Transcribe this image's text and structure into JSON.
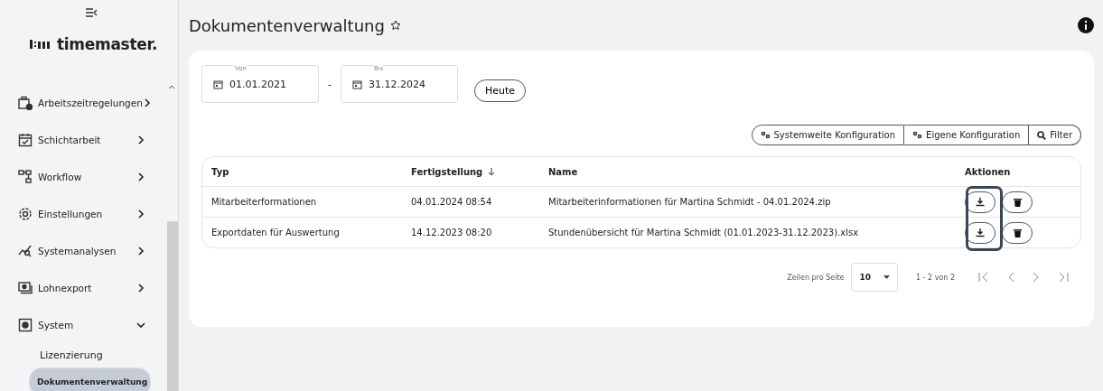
{
  "sidebar": {
    "logo": "timemaster.",
    "items": [
      {
        "label": "Arbeitszeitregelungen",
        "expanded": false
      },
      {
        "label": "Schichtarbeit",
        "expanded": false
      },
      {
        "label": "Workflow",
        "expanded": false
      },
      {
        "label": "Einstellungen",
        "expanded": false
      },
      {
        "label": "Systemanalysen",
        "expanded": false
      },
      {
        "label": "Lohnexport",
        "expanded": false
      },
      {
        "label": "System",
        "expanded": true,
        "children": [
          {
            "label": "Lizenzierung",
            "selected": false
          },
          {
            "label": "Dokumentenverwaltung",
            "selected": true
          }
        ]
      }
    ]
  },
  "page": {
    "title": "Dokumentenverwaltung"
  },
  "filters": {
    "from": {
      "label": "Von",
      "value": "01.01.2021"
    },
    "separator": "-",
    "to": {
      "label": "Bis",
      "value": "31.12.2024"
    },
    "today_button": "Heute"
  },
  "toolbar": [
    {
      "label": "Systemweite Konfiguration",
      "kind": "config"
    },
    {
      "label": "Eigene Konfiguration",
      "kind": "config"
    },
    {
      "label": "Filter",
      "kind": "search"
    }
  ],
  "table": {
    "columns": [
      "Typ",
      "Fertigstellung",
      "Name",
      "Aktionen"
    ],
    "download_highlighted": true,
    "rows": [
      {
        "type": "Mitarbeiterformationen",
        "completed": "04.01.2024 08:54",
        "name": "Mitarbeiterinformationen für Martina Schmidt - 04.01.2024.zip"
      },
      {
        "type": "Exportdaten für Auswertung",
        "completed": "14.12.2023 08:20",
        "name": "Stundenübersicht für Martina Schmidt (01.01.2023-31.12.2023).xlsx"
      }
    ]
  },
  "pagination": {
    "rows_label": "Zeilen pro Seite",
    "rows_value": "10",
    "range": "1 - 2 von 2"
  }
}
